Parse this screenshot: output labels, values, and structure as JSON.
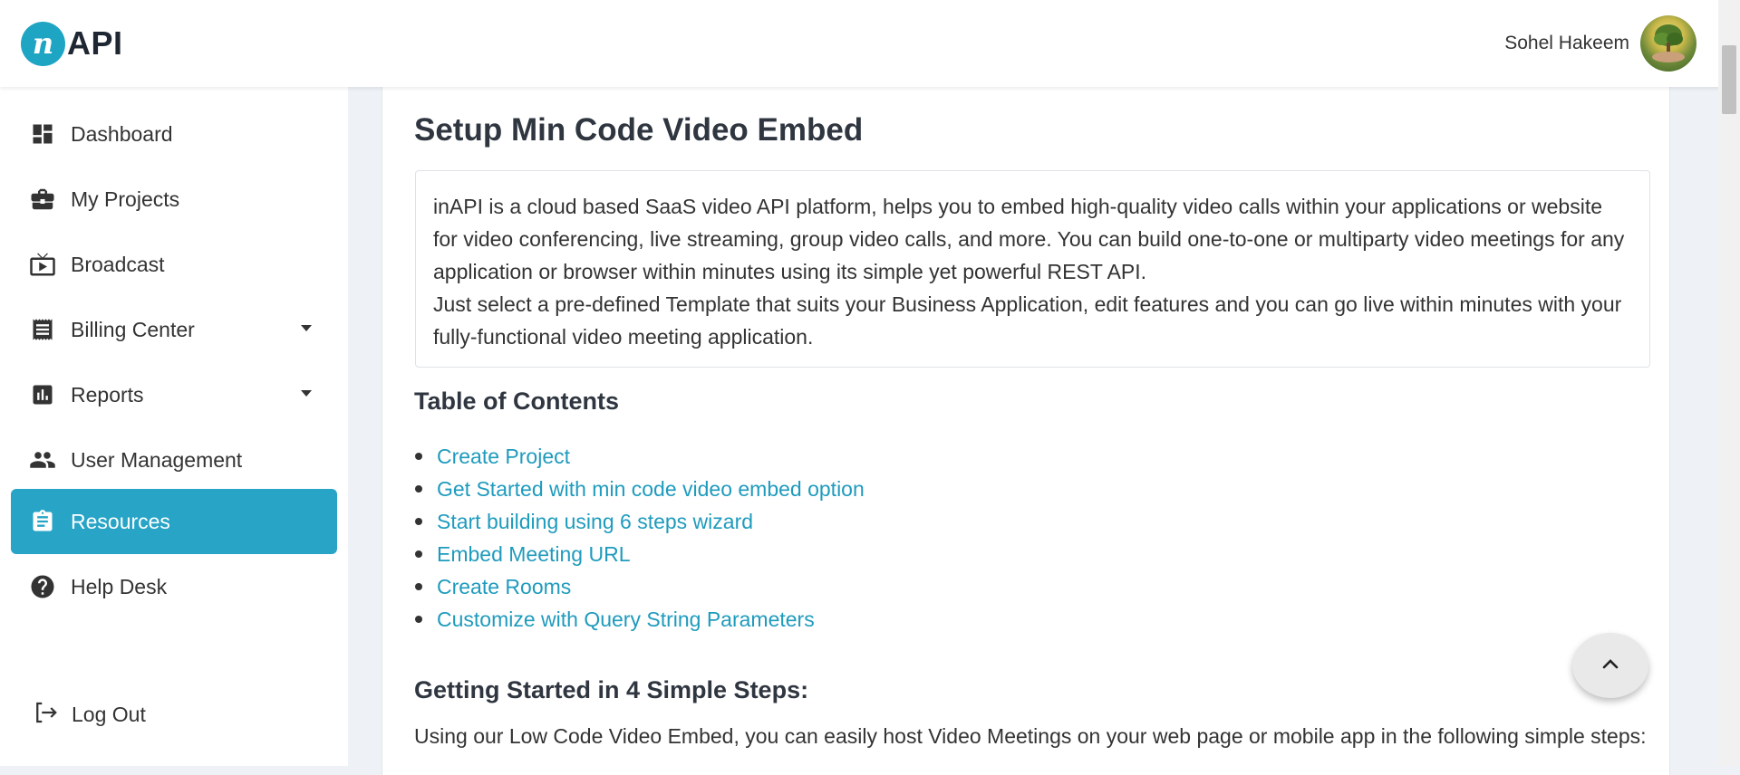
{
  "brand": {
    "logo_letter": "n",
    "logo_text": "API"
  },
  "user": {
    "name": "Sohel Hakeem"
  },
  "sidebar": {
    "items": [
      {
        "label": "Dashboard",
        "icon": "dashboard-icon"
      },
      {
        "label": "My Projects",
        "icon": "briefcase-icon"
      },
      {
        "label": "Broadcast",
        "icon": "tv-icon"
      },
      {
        "label": "Billing Center",
        "icon": "receipt-icon",
        "has_dropdown": true
      },
      {
        "label": "Reports",
        "icon": "bar-chart-icon",
        "has_dropdown": true
      },
      {
        "label": "User Management",
        "icon": "users-icon"
      },
      {
        "label": "Resources",
        "icon": "clipboard-icon",
        "active": true
      },
      {
        "label": "Help Desk",
        "icon": "help-icon"
      }
    ],
    "logout_label": "Log Out"
  },
  "main": {
    "title": "Setup Min Code Video Embed",
    "intro_paragraph_1": "inAPI is a cloud based SaaS video API platform, helps you to embed high-quality video calls within your applications or website for video conferencing, live streaming, group video calls, and more. You can build one-to-one or multiparty video meetings for any application or browser within minutes using its simple yet powerful REST API.",
    "intro_paragraph_2": "Just select a pre-defined Template that suits your Business Application, edit features and you can go live within minutes with your fully-functional video meeting application.",
    "toc_title": "Table of Contents",
    "toc_items": [
      "Create Project",
      "Get Started with min code video embed option",
      "Start building using 6 steps wizard",
      "Embed Meeting URL",
      "Create Rooms",
      "Customize with Query String Parameters"
    ],
    "steps_title": "Getting Started in 4 Simple Steps:",
    "steps_text": "Using our Low Code Video Embed, you can easily host Video Meetings on your web page or mobile app in the following simple steps:"
  },
  "colors": {
    "accent": "#27a4c6",
    "link": "#1f9bbd",
    "logo": "#1ea5c4"
  }
}
